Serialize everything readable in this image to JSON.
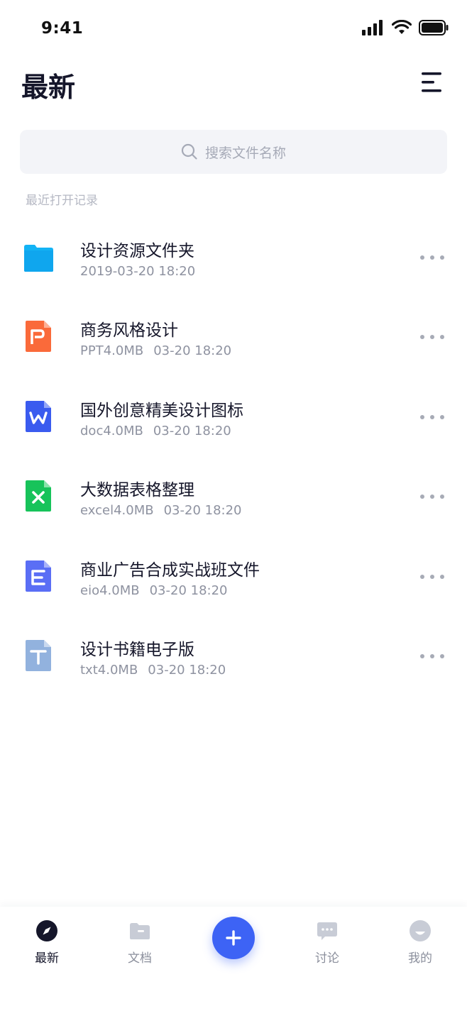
{
  "status_bar": {
    "time": "9:41"
  },
  "header": {
    "title": "最新"
  },
  "search": {
    "placeholder": "搜索文件名称"
  },
  "section": {
    "label": "最近打开记录"
  },
  "files": [
    {
      "name": "设计资源文件夹",
      "type": "",
      "size": "",
      "date": "2019-03-20 18:20",
      "icon": "folder-icon",
      "color": "#13b3f5"
    },
    {
      "name": "商务风格设计",
      "type": "PPT",
      "size": "4.0MB",
      "date": "03-20 18:20",
      "icon": "ppt-file-icon",
      "color": "#fa6a3a",
      "letter": "P"
    },
    {
      "name": "国外创意精美设计图标",
      "type": "doc",
      "size": "4.0MB",
      "date": "03-20 18:20",
      "icon": "word-file-icon",
      "color": "#3a5bef",
      "letter": "W"
    },
    {
      "name": "大数据表格整理",
      "type": "excel",
      "size": "4.0MB",
      "date": "03-20 18:20",
      "icon": "excel-file-icon",
      "color": "#17c35a",
      "letter": "X"
    },
    {
      "name": "商业广告合成实战班文件",
      "type": "eio",
      "size": "4.0MB",
      "date": "03-20 18:20",
      "icon": "eio-file-icon",
      "color": "#5a6ef5",
      "letter": "E"
    },
    {
      "name": "设计书籍电子版",
      "type": "txt",
      "size": "4.0MB",
      "date": "03-20 18:20",
      "icon": "txt-file-icon",
      "color": "#92b2de",
      "letter": "T"
    }
  ],
  "tabs": [
    {
      "label": "最新",
      "active": true
    },
    {
      "label": "文档",
      "active": false
    },
    {
      "label": "讨论",
      "active": false
    },
    {
      "label": "我的",
      "active": false
    }
  ],
  "colors": {
    "accent": "#3d63f5",
    "text": "#15162a",
    "muted": "#8e92a0"
  }
}
